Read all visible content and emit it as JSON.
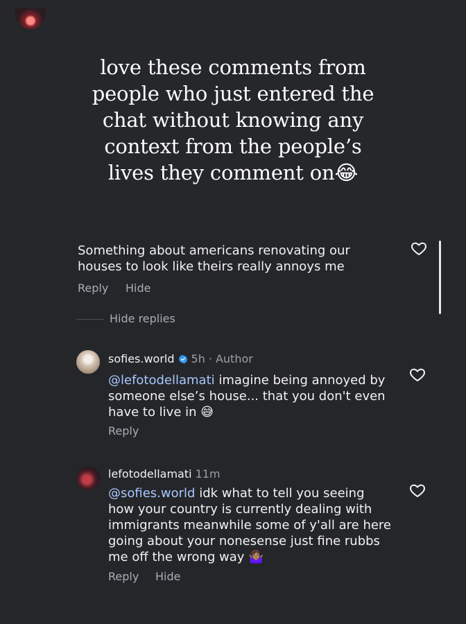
{
  "headline": "love these comments from\npeople who just entered the\nchat without knowing any\ncontext from the people’s\nlives they comment on",
  "headline_emoji": "😂",
  "comments": [
    {
      "text": "Something about americans renovating our\nhouses to look like theirs really annoys me",
      "reply_label": "Reply",
      "hide_label": "Hide",
      "replies_toggle": "Hide replies"
    }
  ],
  "replies": [
    {
      "username": "sofies.world",
      "time": "5h",
      "separator": "·",
      "role": "Author",
      "mention": "@lefotodellamati",
      "text_part1": " imagine being annoyed by\nsomeone else’s house... that you don't even\nhave to live in ",
      "emoji": "😅",
      "reply_label": "Reply"
    },
    {
      "username": "lefotodellamati",
      "time": "11m",
      "mention": "@sofies.world",
      "text_part1": " idk what to tell you seeing\nhow your country is currently dealing with\nimmigrants meanwhile some of y'all are here\ngoing about your nonesense just fine rubbs\nme off the wrong way ",
      "emoji": "🤷🏽‍♀️",
      "reply_label": "Reply",
      "hide_label": "Hide"
    }
  ],
  "icons": {
    "heart": "heart-icon",
    "verified": "verified-badge-icon"
  },
  "colors": {
    "background": "#25272a",
    "text": "#f2f2f2",
    "muted": "#9aa0a6",
    "mention": "#a9c7ff",
    "verified": "#3797f0"
  }
}
